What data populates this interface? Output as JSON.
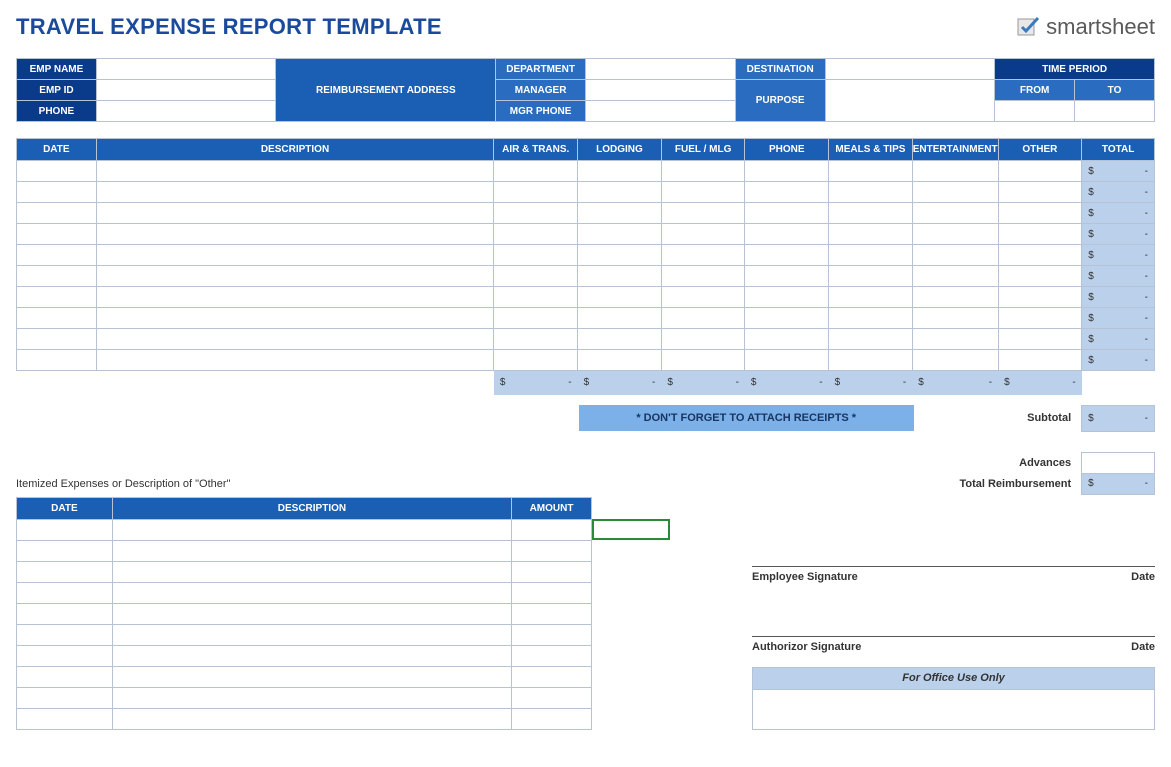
{
  "title": "TRAVEL EXPENSE REPORT TEMPLATE",
  "logo_text": "smartsheet",
  "info": {
    "emp_name": "EMP NAME",
    "emp_id": "EMP ID",
    "phone": "PHONE",
    "reimb_addr": "REIMBURSEMENT ADDRESS",
    "department": "DEPARTMENT",
    "manager": "MANAGER",
    "mgr_phone": "MGR PHONE",
    "destination": "DESTINATION",
    "purpose": "PURPOSE",
    "time_period": "TIME PERIOD",
    "from": "FROM",
    "to": "TO"
  },
  "main_headers": {
    "date": "DATE",
    "description": "DESCRIPTION",
    "air": "AIR & TRANS.",
    "lodging": "LODGING",
    "fuel": "FUEL / MLG",
    "phone": "PHONE",
    "meals": "MEALS & TIPS",
    "entertainment": "ENTERTAINMENT",
    "other": "OTHER",
    "total": "TOTAL"
  },
  "row_total": {
    "sym": "$",
    "dash": "-"
  },
  "col_total": {
    "sym": "$",
    "dash": "-"
  },
  "receipts_note": "* DON'T FORGET TO ATTACH RECEIPTS *",
  "summary": {
    "subtotal_label": "Subtotal",
    "advances_label": "Advances",
    "total_reimb_label": "Total Reimbursement",
    "sym": "$",
    "dash": "-"
  },
  "itemized_title": "Itemized Expenses or Description of \"Other\"",
  "item_headers": {
    "date": "DATE",
    "description": "DESCRIPTION",
    "amount": "AMOUNT"
  },
  "signatures": {
    "emp": "Employee Signature",
    "auth": "Authorizor Signature",
    "date": "Date"
  },
  "office_use": "For Office Use Only"
}
